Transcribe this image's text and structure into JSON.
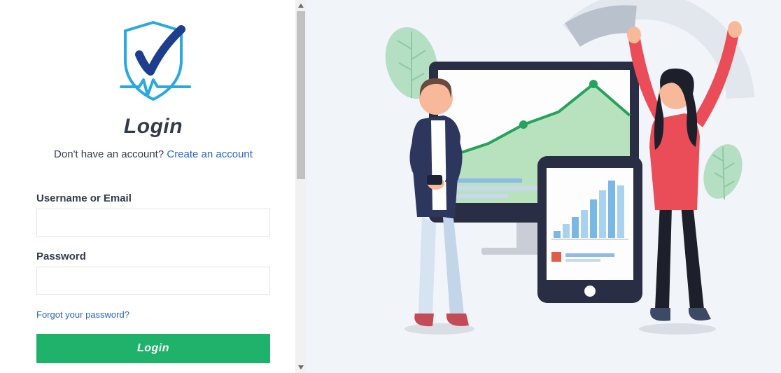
{
  "login": {
    "heading": "Login",
    "signup_prompt": "Don't have an account? ",
    "signup_link": "Create an account",
    "username_label": "Username or Email",
    "password_label": "Password",
    "forgot_link": "Forgot your password?",
    "button_label": "Login",
    "username_value": "",
    "password_value": ""
  }
}
